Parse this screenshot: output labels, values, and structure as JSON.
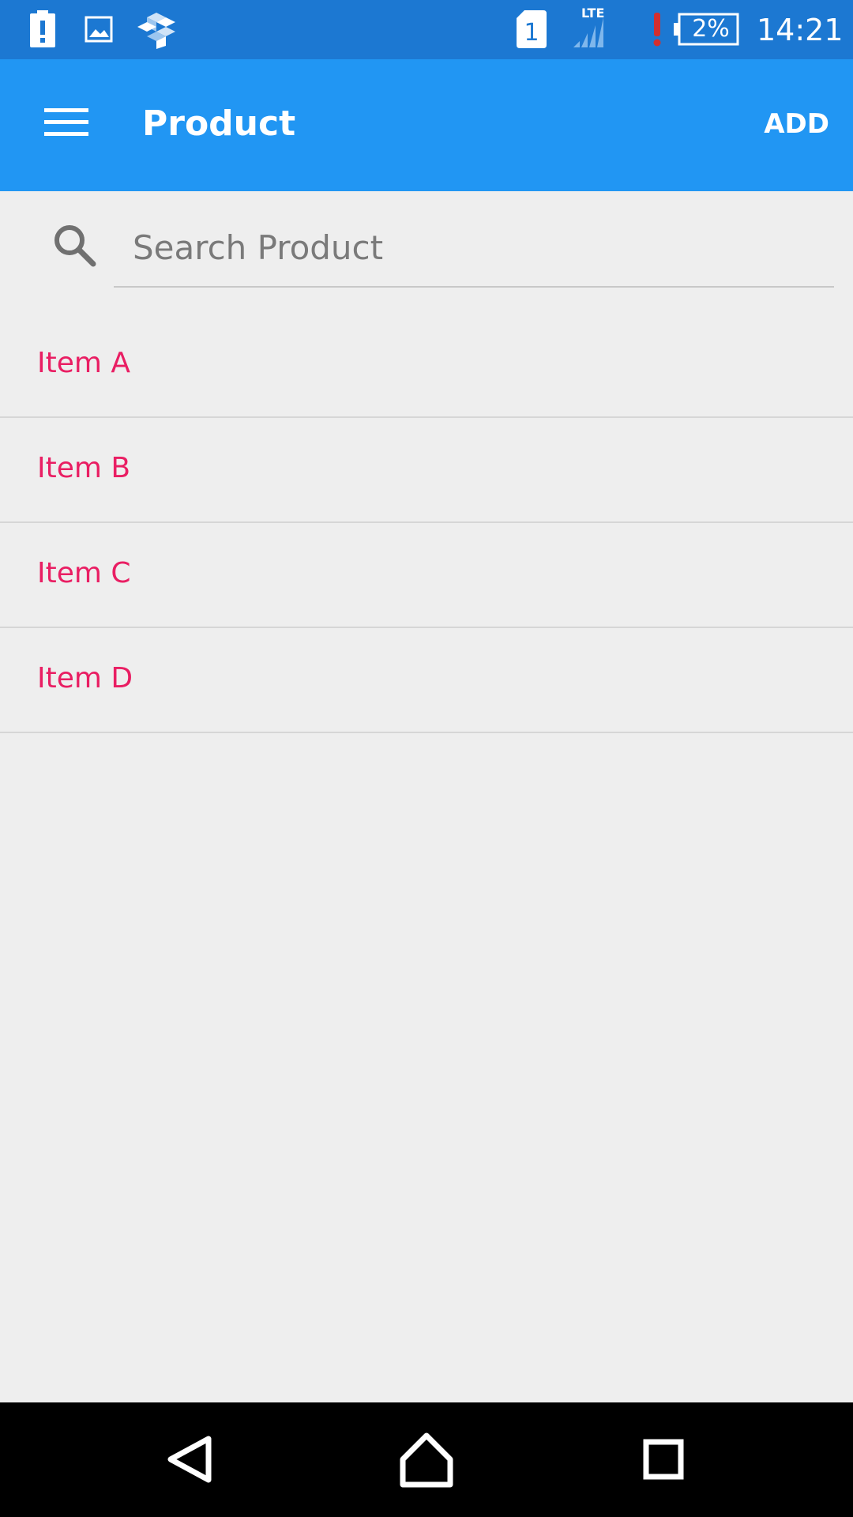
{
  "status_bar": {
    "battery_percent": "2%",
    "time": "14:21",
    "network_label": "LTE",
    "sim_slot": "1",
    "icons": [
      "battery-alert-icon",
      "gallery-icon",
      "app-cluster-icon",
      "sim-card-icon",
      "signal-icon",
      "warning-icon",
      "battery-icon"
    ]
  },
  "app_bar": {
    "title": "Product",
    "action_label": "ADD",
    "menu_icon": "hamburger-menu-icon",
    "background_color": "#2196f3"
  },
  "search": {
    "placeholder": "Search Product",
    "value": "",
    "icon": "search-icon"
  },
  "products": {
    "item_color": "#e91e63",
    "items": [
      {
        "label": "Item A"
      },
      {
        "label": "Item B"
      },
      {
        "label": "Item C"
      },
      {
        "label": "Item D"
      }
    ]
  },
  "nav_bar": {
    "buttons": [
      "back-icon",
      "home-icon",
      "recents-icon"
    ]
  }
}
